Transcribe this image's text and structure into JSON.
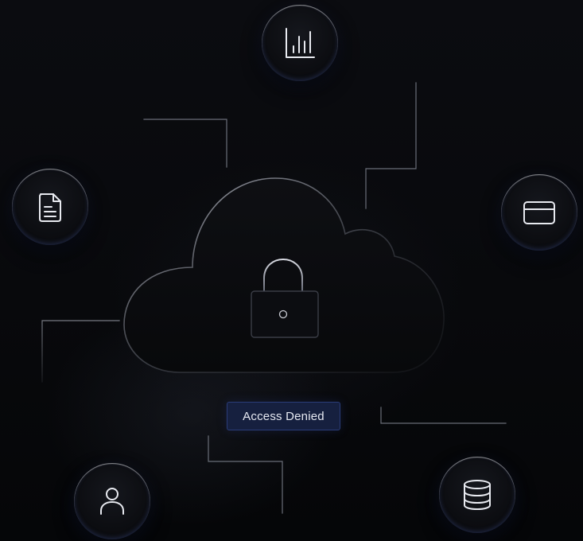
{
  "status": {
    "badge_label": "Access Denied"
  },
  "icons": {
    "top": "bar-chart-icon",
    "left": "document-icon",
    "right": "credit-card-icon",
    "bottom_left": "user-icon",
    "bottom_right": "database-icon",
    "center": "padlock-icon",
    "container": "cloud-icon"
  },
  "colors": {
    "background": "#07080b",
    "badge_background": "#16203f",
    "badge_border": "#2a3c78",
    "badge_text": "#e6e9f2",
    "icon_stroke": "#e8eaf0",
    "wire": "#6a6e78"
  }
}
